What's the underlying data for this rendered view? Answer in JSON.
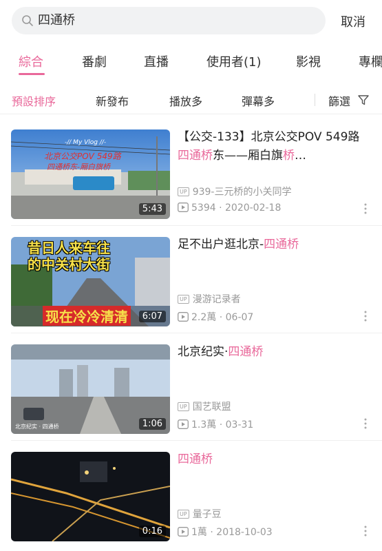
{
  "search": {
    "query": "四通桥",
    "cancel_label": "取消"
  },
  "tabs": [
    {
      "label": "綜合",
      "active": true
    },
    {
      "label": "番劇"
    },
    {
      "label": "直播"
    },
    {
      "label": "使用者(1)"
    },
    {
      "label": "影視"
    },
    {
      "label": "專欄"
    }
  ],
  "sort": {
    "options": [
      "預設排序",
      "新發布",
      "播放多",
      "彈幕多"
    ],
    "filter_label": "篩選"
  },
  "results": [
    {
      "title_pre": "【公交-133】北京公交POV 549路 ",
      "title_hl": "四通桥",
      "title_post": "东——厢白旗",
      "title_hl2": "桥",
      "title_tail": "…",
      "thumb_overlay_line1": "-// My Vlog //-",
      "thumb_overlay_line2": "北京公交POV 549路",
      "thumb_overlay_line3": "四通桥东-厢白旗桥",
      "duration": "5:43",
      "uploader": "939-三元桥的小关同学",
      "views": "5394",
      "date": "2020-02-18",
      "up_badge": "UP"
    },
    {
      "title_pre": "足不出户逛北京-",
      "title_hl": "四通桥",
      "thumb_overlay_line1": "昔日人来车往",
      "thumb_overlay_line2": "的中关村大街",
      "thumb_overlay_line3": "现在冷冷清清",
      "duration": "6:07",
      "uploader": "漫游记录者",
      "views": "2.2萬",
      "date": "06-07",
      "up_badge": "UP"
    },
    {
      "title_pre": "北京纪实·",
      "title_hl": "四通桥",
      "thumb_overlay_line1": "北京纪实 · 四通桥",
      "duration": "1:06",
      "uploader": "国艺联盟",
      "views": "1.3萬",
      "date": "03-31",
      "up_badge": "UP"
    },
    {
      "title_pre": "",
      "title_hl": "四通桥",
      "duration": "0:16",
      "uploader": "量子豆",
      "views": "1萬",
      "date": "2018-10-03",
      "up_badge": "UP"
    }
  ],
  "colors": {
    "accent": "#e9689a",
    "muted": "#999999"
  }
}
